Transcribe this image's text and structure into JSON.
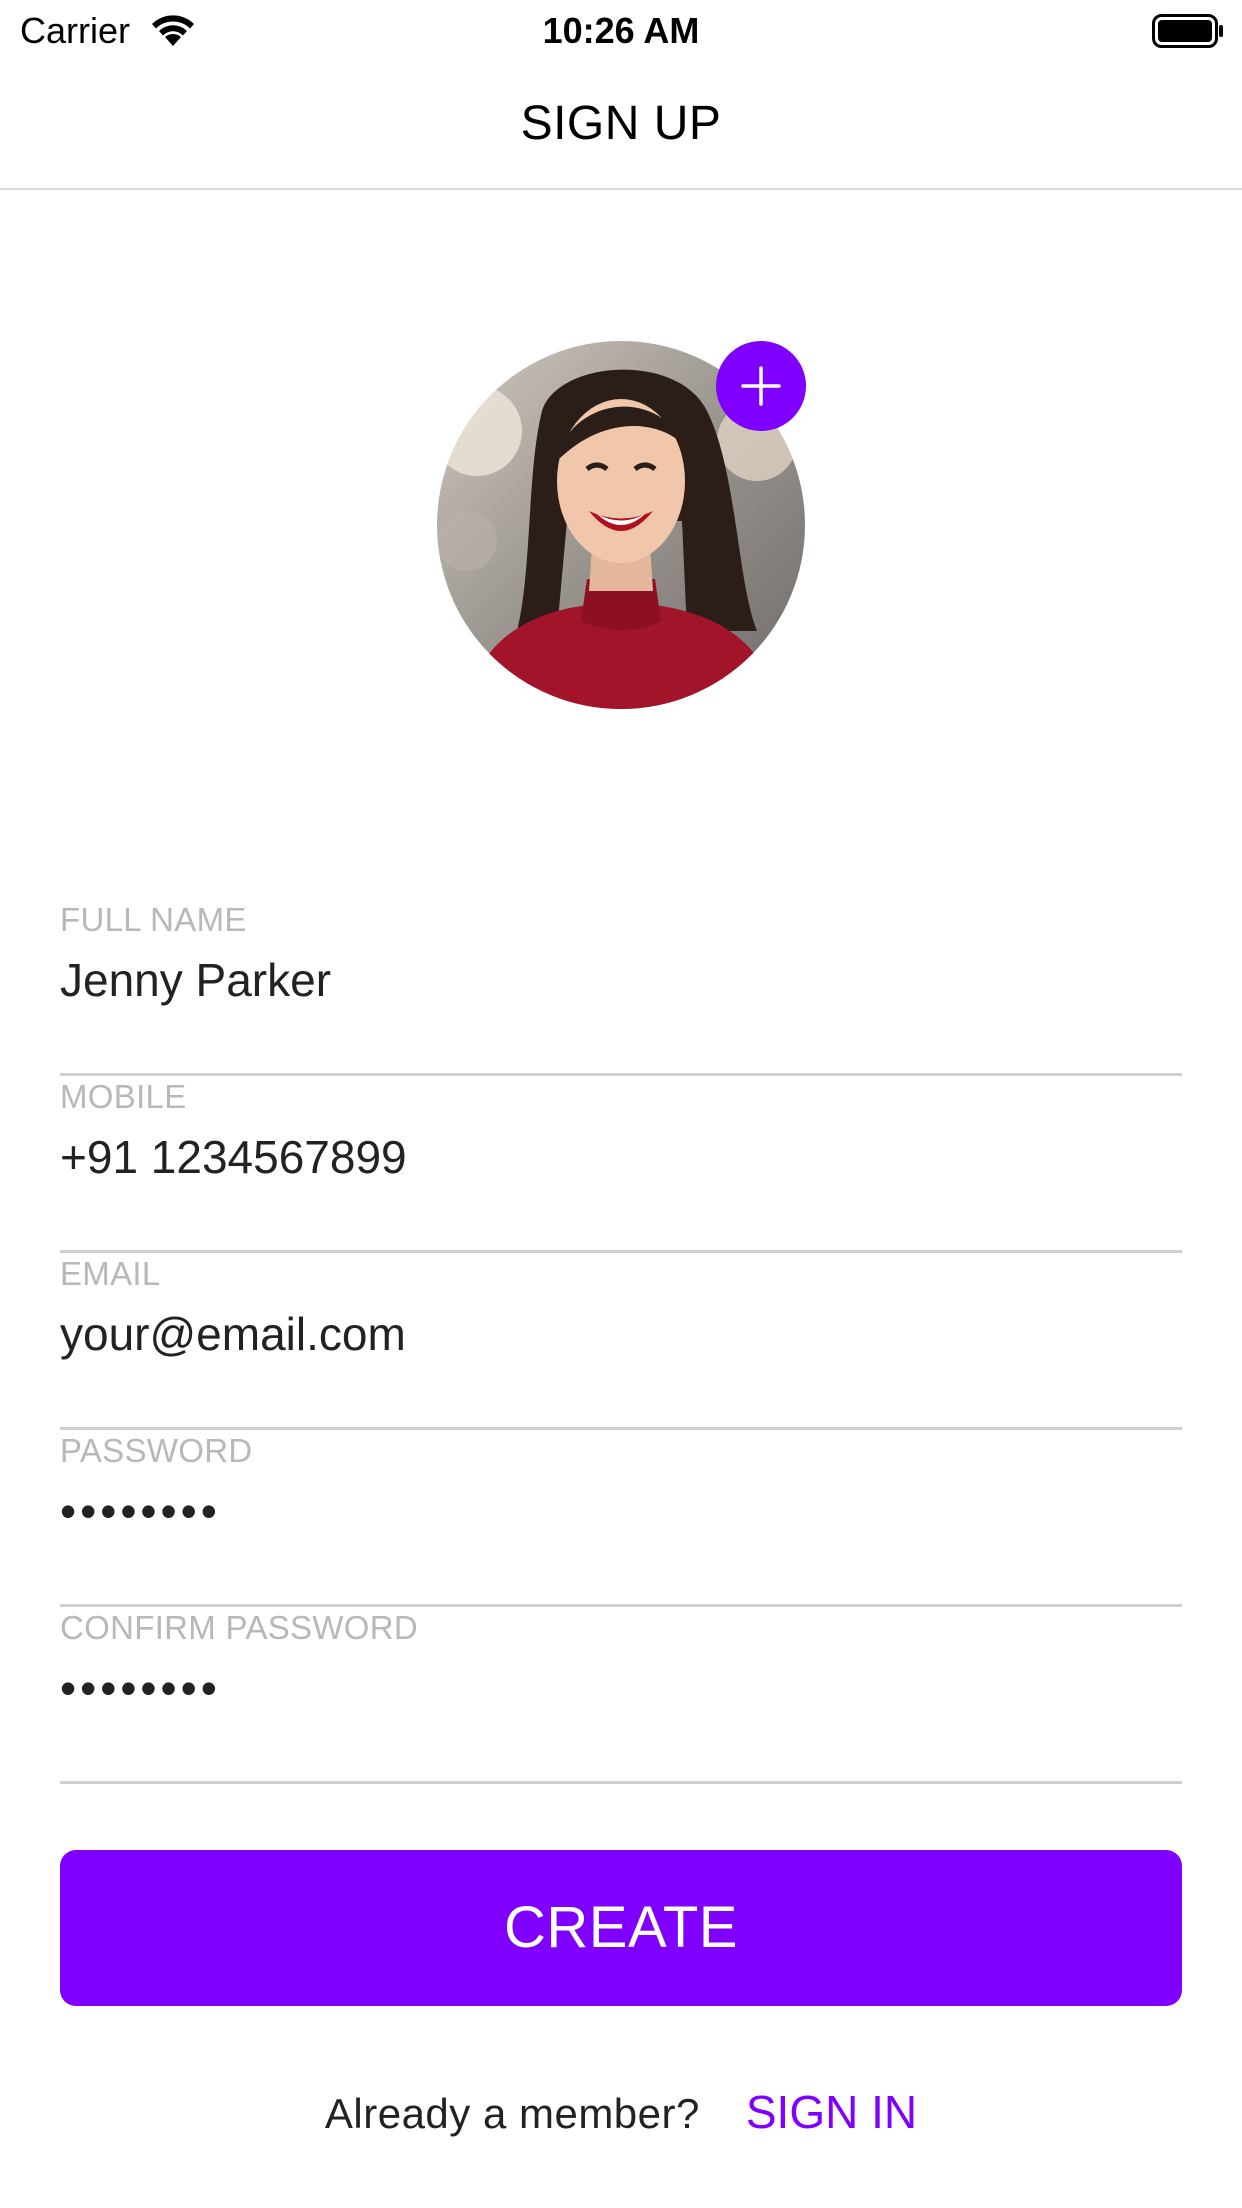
{
  "status_bar": {
    "carrier": "Carrier",
    "time": "10:26 AM",
    "wifi_icon": "wifi-icon",
    "battery_icon": "battery-full-icon"
  },
  "nav": {
    "title": "SIGN UP"
  },
  "avatar": {
    "add_icon": "plus-icon",
    "accent_color": "#7F00FF"
  },
  "form": {
    "fields": [
      {
        "label": "FULL NAME",
        "value": "Jenny Parker"
      },
      {
        "label": "MOBILE",
        "value": "+91 1234567899"
      },
      {
        "label": "EMAIL",
        "value": "your@email.com"
      },
      {
        "label": "PASSWORD",
        "value": "••••••••"
      },
      {
        "label": "CONFIRM PASSWORD",
        "value": "••••••••"
      }
    ]
  },
  "actions": {
    "create_label": "CREATE"
  },
  "footer": {
    "prompt": "Already a member?",
    "sign_in_label": "SIGN IN"
  },
  "colors": {
    "accent": "#7F00FF",
    "label": "#B8B8B8",
    "divider": "#CFCFCF"
  }
}
